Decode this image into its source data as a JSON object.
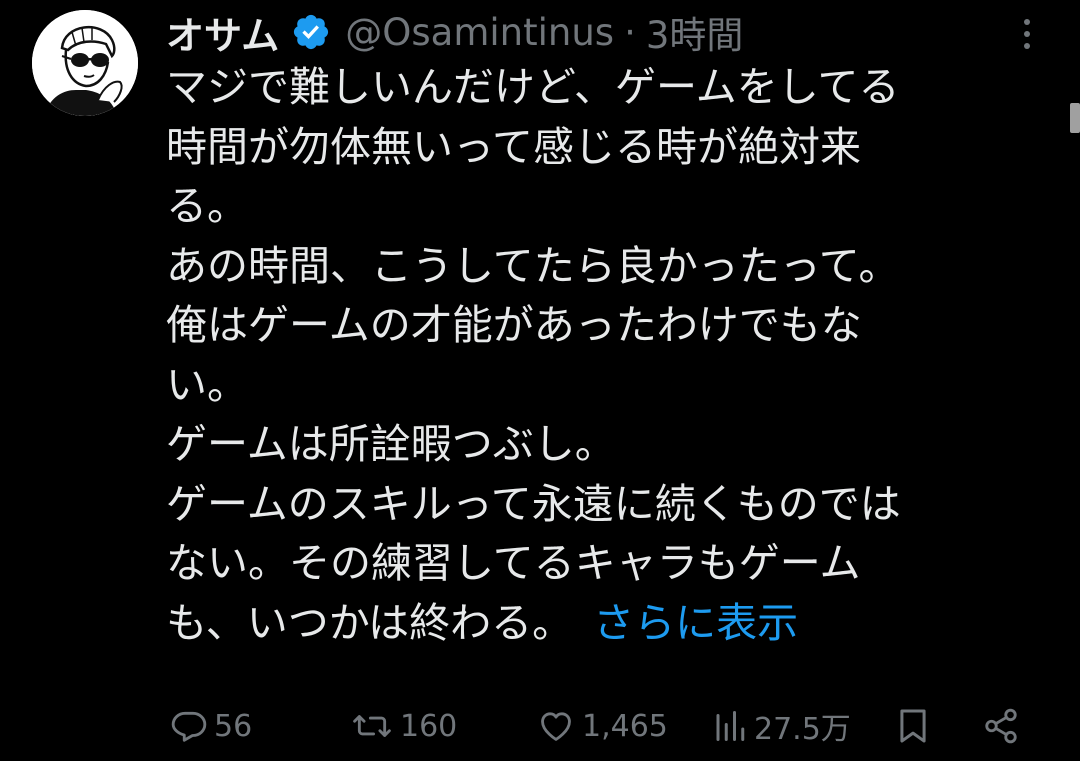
{
  "tweet": {
    "author": {
      "display_name": "オサム",
      "handle": "@Osamintinus",
      "verified": true,
      "avatar_icon": "avatar-sunglasses-illustration"
    },
    "separator": "·",
    "timestamp": "3時間",
    "lines": [
      "マジで難しいんだけど、ゲームをしてる",
      "時間が勿体無いって感じる時が絶対来",
      "る。",
      "あの時間、こうしてたら良かったって。",
      "俺はゲームの才能があったわけでもな",
      "い。",
      "ゲームは所詮暇つぶし。",
      "ゲームのスキルって永遠に続くものでは",
      "ない。その練習してるキャラもゲーム",
      "も、いつかは終わる。"
    ],
    "show_more_label": "さらに表示",
    "metrics": {
      "replies": "56",
      "reposts": "160",
      "likes": "1,465",
      "views": "27.5万"
    }
  },
  "colors": {
    "background": "#000000",
    "text": "#e7e9ea",
    "secondary": "#71767b",
    "link": "#1d9bf0",
    "verified_badge": "#1d9bf0"
  },
  "icons": {
    "more": "more-vertical-icon",
    "reply": "reply-icon",
    "repost": "repost-icon",
    "like": "heart-icon",
    "views": "views-icon",
    "bookmark": "bookmark-icon",
    "share": "share-icon"
  }
}
